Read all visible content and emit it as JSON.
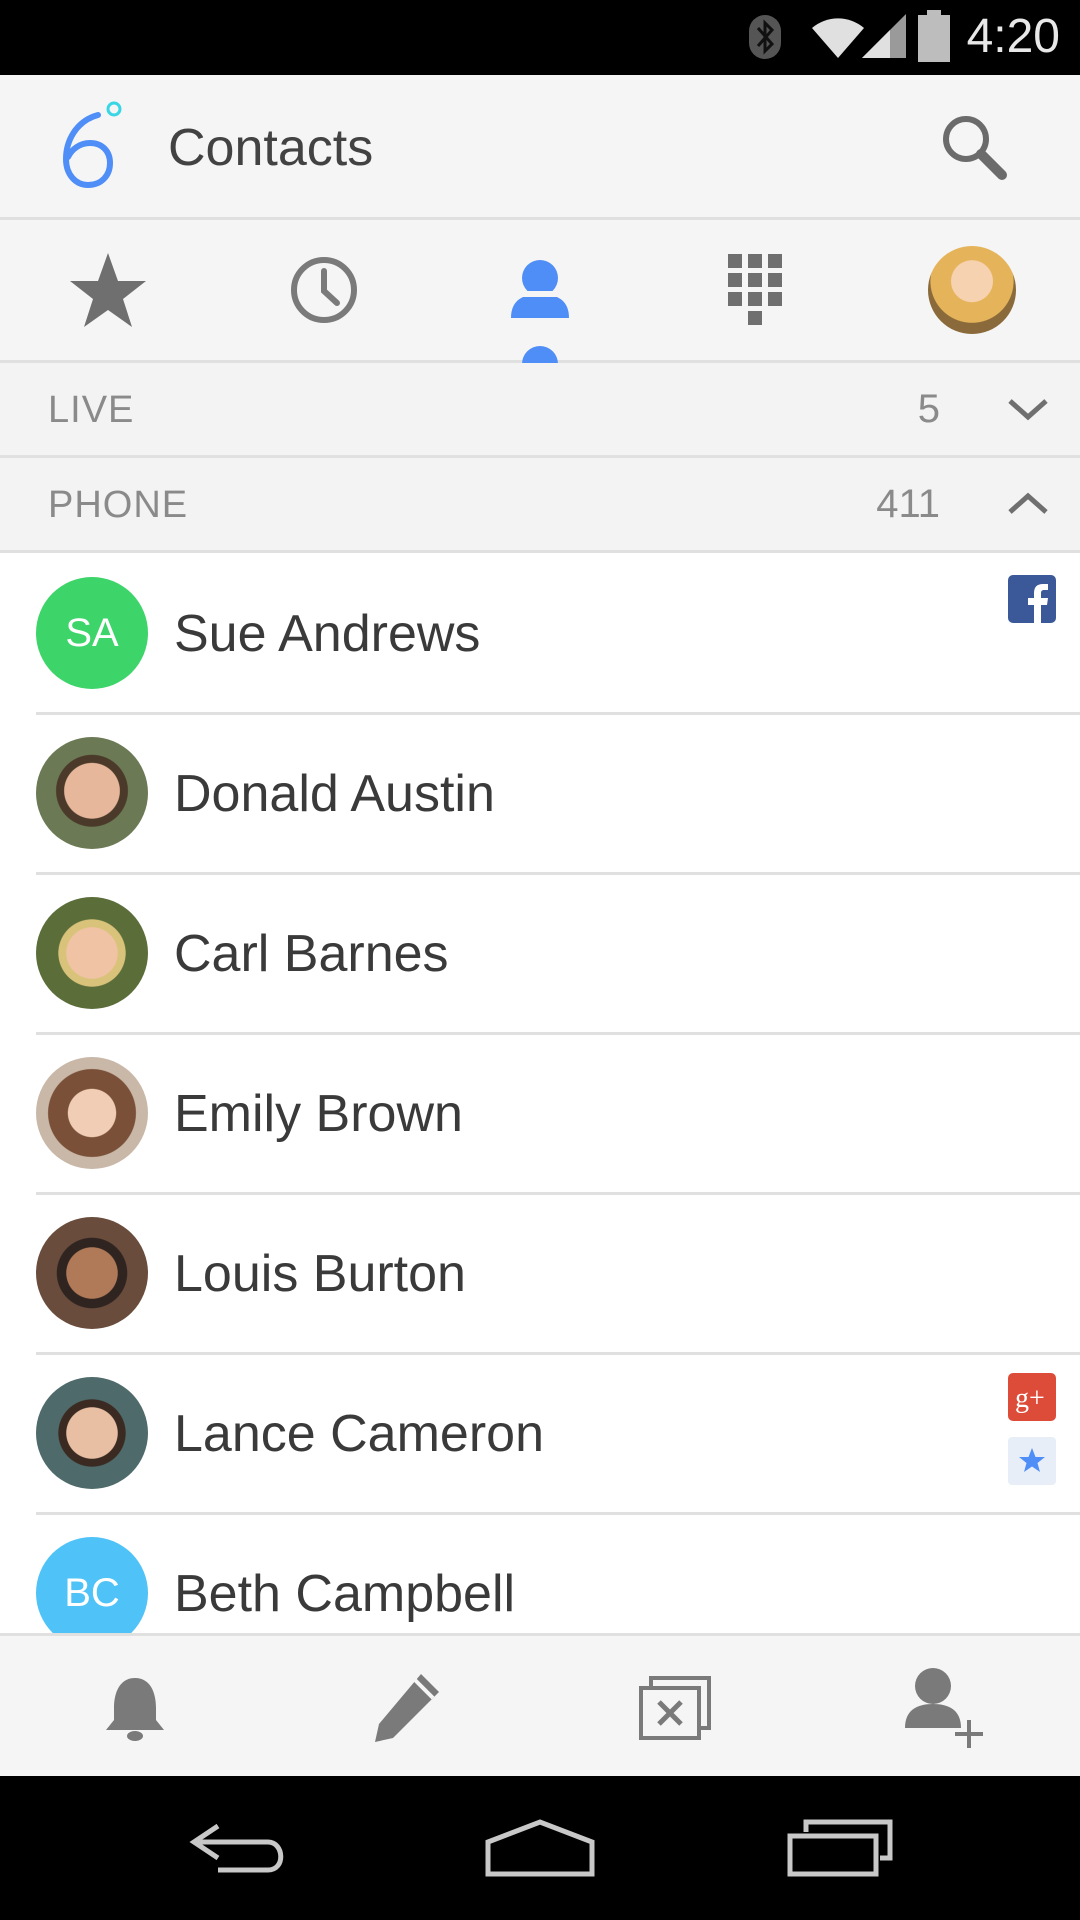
{
  "status_bar": {
    "time": "4:20"
  },
  "app_bar": {
    "title": "Contacts",
    "logo_icon": "six-degrees-logo-icon",
    "search_icon": "search-icon"
  },
  "tabs": [
    {
      "icon": "star-icon",
      "selected": false
    },
    {
      "icon": "clock-icon",
      "selected": false
    },
    {
      "icon": "person-icon",
      "selected": true
    },
    {
      "icon": "dialpad-icon",
      "selected": false
    },
    {
      "icon": "profile-avatar",
      "selected": false
    }
  ],
  "sections": {
    "live": {
      "label": "LIVE",
      "count": "5",
      "expanded": false
    },
    "phone": {
      "label": "PHONE",
      "count": "411",
      "expanded": true
    }
  },
  "contacts": [
    {
      "name": "Sue Andrews",
      "initials": "SA",
      "avatar_color": "#3dd46a",
      "badges": [
        "facebook-badge"
      ]
    },
    {
      "name": "Donald Austin",
      "initials": "",
      "avatar_color": "#6b7a55",
      "badges": []
    },
    {
      "name": "Carl Barnes",
      "initials": "",
      "avatar_color": "#5b6e3a",
      "badges": []
    },
    {
      "name": "Emily Brown",
      "initials": "",
      "avatar_color": "#8a6a55",
      "badges": []
    },
    {
      "name": "Louis Burton",
      "initials": "",
      "avatar_color": "#6a4c3c",
      "badges": []
    },
    {
      "name": "Lance Cameron",
      "initials": "",
      "avatar_color": "#4e6a6a",
      "badges": [
        "google-plus-badge",
        "favorite-star-badge"
      ]
    },
    {
      "name": "Beth Campbell",
      "initials": "BC",
      "avatar_color": "#4fc3f7",
      "badges": []
    }
  ],
  "bottom_actions": [
    "bell-icon",
    "pencil-icon",
    "delete-box-icon",
    "add-contact-icon"
  ],
  "nav_bar": [
    "back-icon",
    "home-icon",
    "recents-icon"
  ],
  "colors": {
    "accent": "#4f8ef7",
    "icon_gray": "#7a7a7a",
    "facebook": "#3b5998",
    "google_plus": "#dd4b39"
  }
}
